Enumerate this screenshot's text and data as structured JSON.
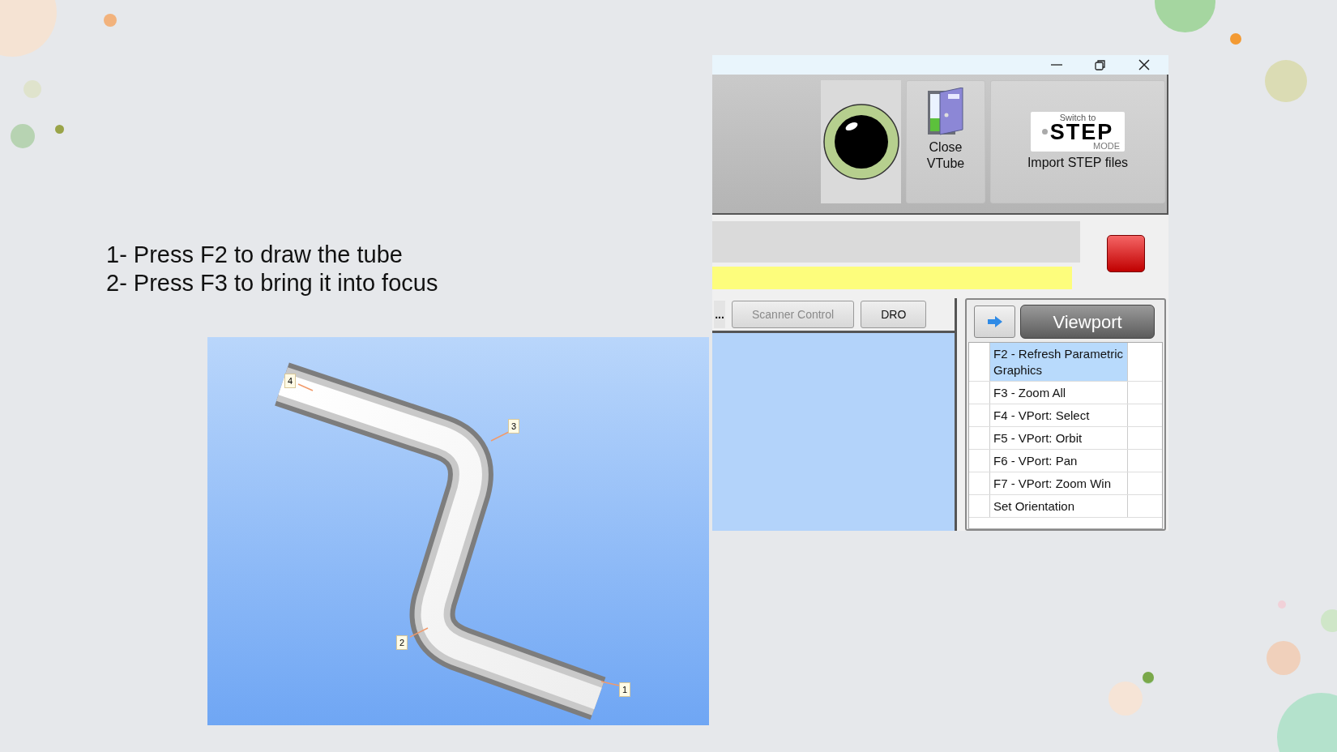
{
  "instructions": [
    "1- Press F2 to draw the tube",
    "2- Press F3 to bring it into focus"
  ],
  "tube_view": {
    "point_labels": [
      "4",
      "3",
      "2",
      "1"
    ]
  },
  "app": {
    "toolbar": [
      {
        "kind": "eye"
      },
      {
        "kind": "door",
        "label": "Close VTube"
      },
      {
        "kind": "step",
        "logo_top": "Switch to",
        "logo_main": "STEP",
        "logo_sub": "MODE",
        "label": "Import STEP files"
      }
    ],
    "tabs": [
      {
        "kind": "grip",
        "label": "...",
        "disabled": false
      },
      {
        "kind": "button",
        "label": "Scanner Control",
        "disabled": true
      },
      {
        "kind": "button",
        "label": "DRO",
        "disabled": false
      }
    ],
    "viewport_panel": {
      "title": "Viewport",
      "commands": [
        {
          "label": "F2 - Refresh Parametric Graphics",
          "selected": true
        },
        {
          "label": "F3 - Zoom All",
          "selected": false
        },
        {
          "label": "F4 - VPort: Select",
          "selected": false
        },
        {
          "label": "F5 - VPort: Orbit",
          "selected": false
        },
        {
          "label": "F6 - VPort: Pan",
          "selected": false
        },
        {
          "label": "F7 - VPort: Zoom Win",
          "selected": false
        },
        {
          "label": "Set Orientation",
          "selected": false
        }
      ]
    }
  }
}
